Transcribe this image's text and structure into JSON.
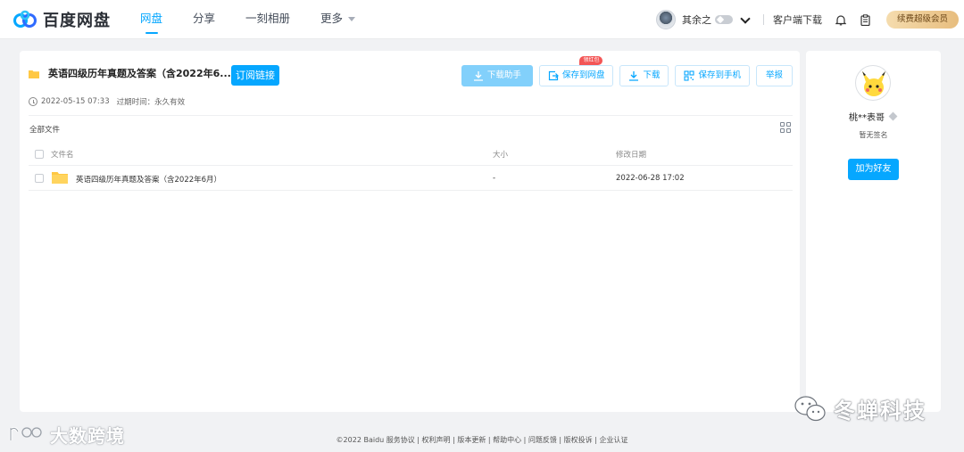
{
  "app": {
    "name": "百度网盘"
  },
  "nav": {
    "items": [
      "网盘",
      "分享",
      "一刻相册",
      "更多"
    ],
    "active_index": 0
  },
  "header": {
    "user_name": "其余之",
    "client_download": "客户端下载",
    "renew_vip": "续费超级会员"
  },
  "share": {
    "title": "英语四级历年真题及答案（含2022年6...",
    "subscribe_label": "订阅链接",
    "created": "2022-05-15 07:33",
    "expire": "过期时间：永久有效"
  },
  "actions": {
    "download_helper": "下载助手",
    "save_to_pan": "保存到网盘",
    "save_badge": "领红包",
    "download": "下载",
    "save_to_phone": "保存到手机",
    "report": "举报"
  },
  "file_list": {
    "breadcrumb": "全部文件",
    "columns": {
      "name": "文件名",
      "size": "大小",
      "modified": "修改日期"
    },
    "rows": [
      {
        "name": "英语四级历年真题及答案（含2022年6月）",
        "size": "-",
        "modified": "2022-06-28 17:02"
      }
    ]
  },
  "sharer": {
    "name": "桃**表哥",
    "signature": "暂无签名",
    "add_friend": "加为好友"
  },
  "footer": {
    "text": "©2022 Baidu  服务协议 | 权利声明 | 版本更新 | 帮助中心 | 问题反馈 | 版权投诉 | 企业认证"
  },
  "watermarks": {
    "left": "大数跨境",
    "right": "冬蝉科技"
  },
  "colors": {
    "accent": "#06a7ff",
    "badge_red": "#f35656",
    "folder": "#ffc844"
  }
}
